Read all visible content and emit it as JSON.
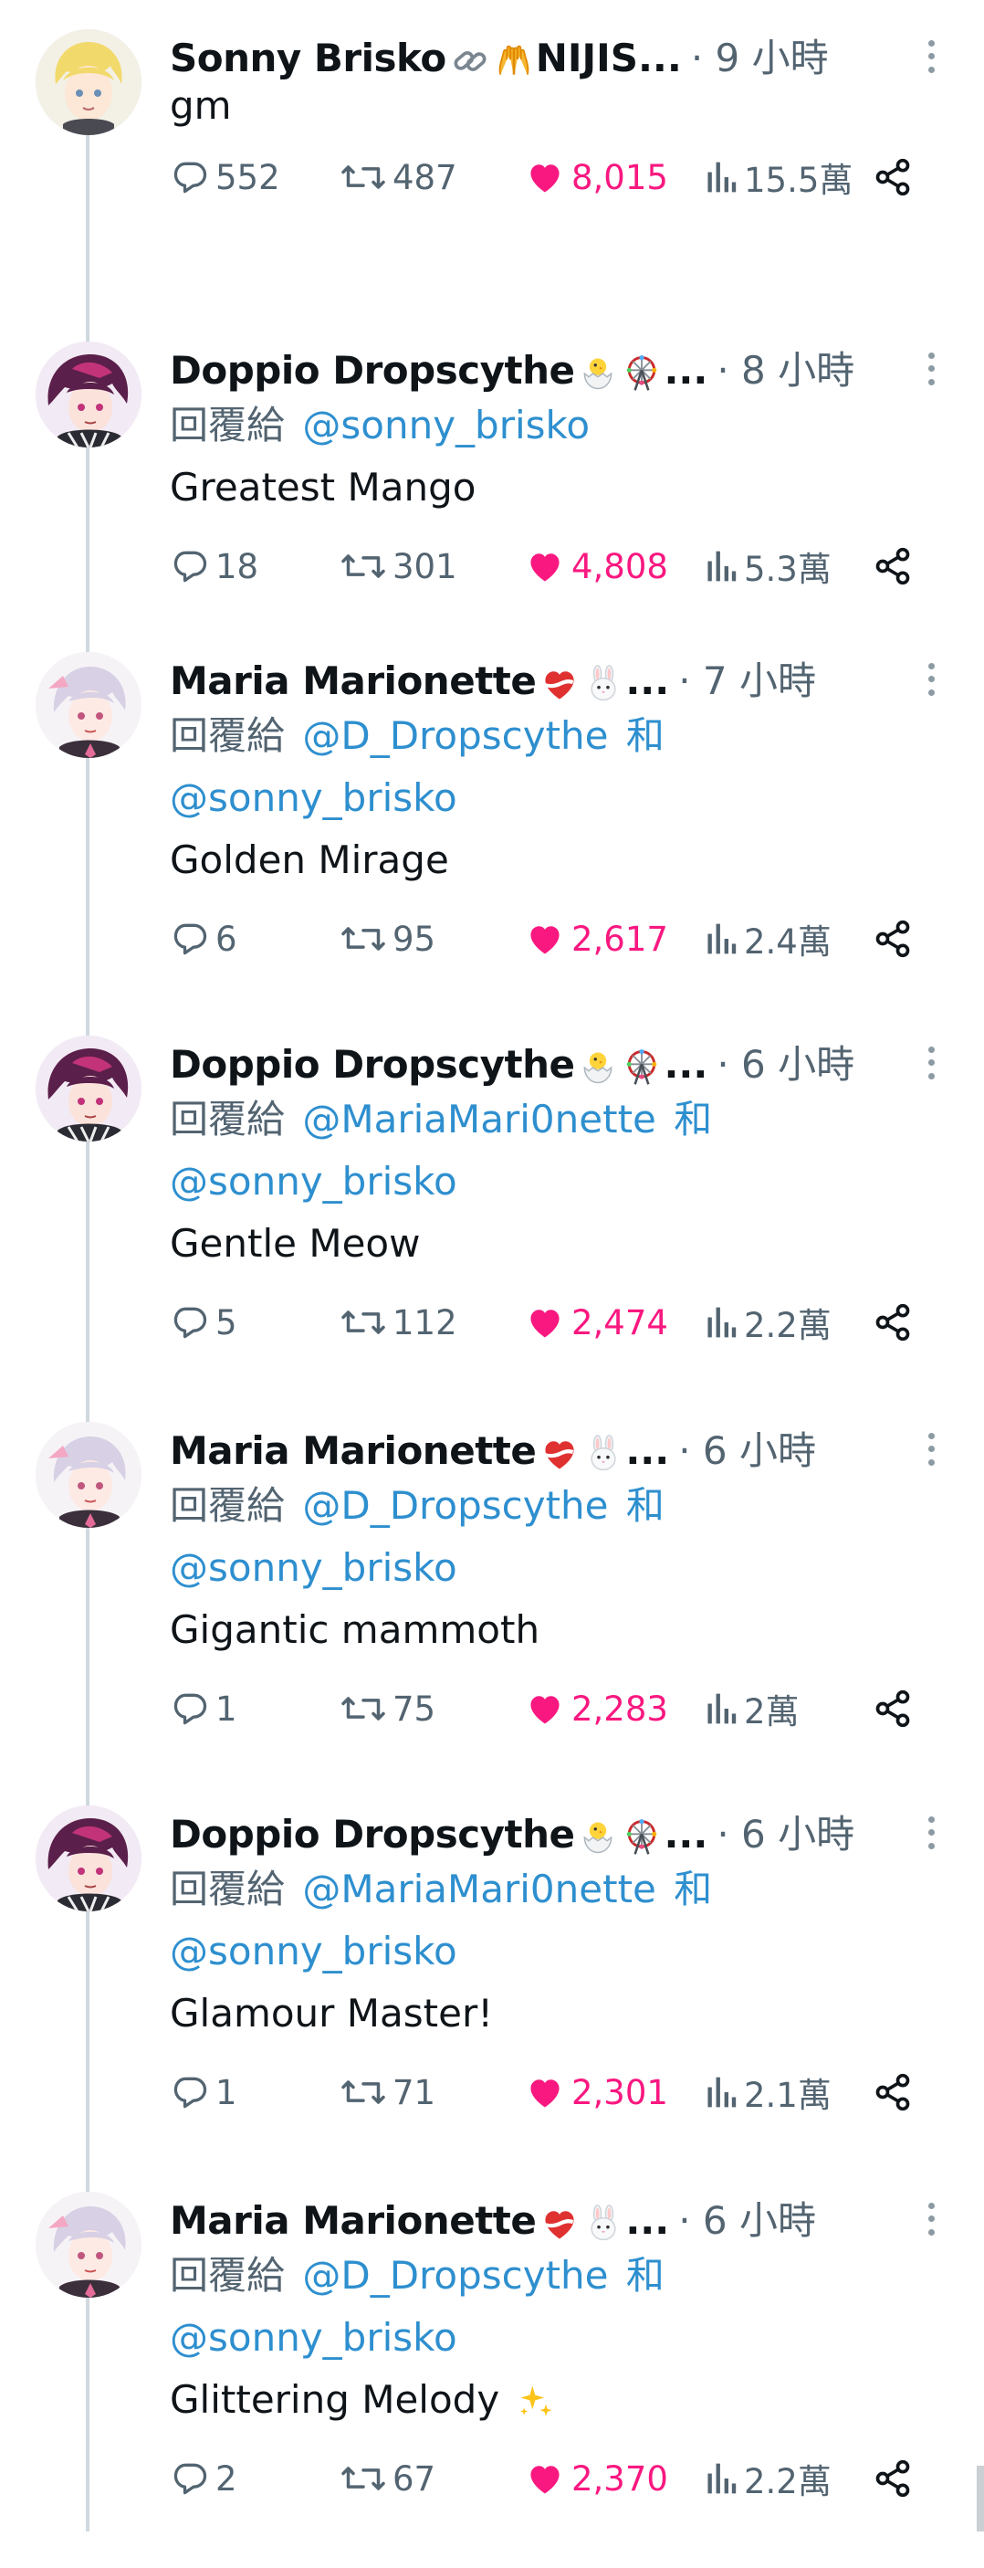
{
  "tweets": [
    {
      "name": "Sonny Brisko",
      "name_suffix": "NIJIS...",
      "emojis": [
        "link-icon",
        "hands-icon"
      ],
      "time": "9 小時",
      "reply_prefix": "",
      "mention_line1": "",
      "mention_and": "",
      "mention_line2": "",
      "text": "gm",
      "replies": "552",
      "retweets": "487",
      "likes": "8,015",
      "views": "15.5萬",
      "avatar": "sonny"
    },
    {
      "name": "Doppio Dropscythe",
      "name_suffix": "...",
      "emojis": [
        "hatching-chick-icon",
        "ferris-wheel-icon"
      ],
      "time": "8 小時",
      "reply_prefix": "回覆給",
      "mention_line1": "@sonny_brisko",
      "mention_and": "",
      "mention_line2": "",
      "text": "Greatest Mango",
      "replies": "18",
      "retweets": "301",
      "likes": "4,808",
      "views": "5.3萬",
      "avatar": "doppio"
    },
    {
      "name": "Maria Marionette",
      "name_suffix": "...",
      "emojis": [
        "heart-ribbon-icon",
        "rabbit-face-icon"
      ],
      "time": "7 小時",
      "reply_prefix": "回覆給",
      "mention_line1": "@D_Dropscythe",
      "mention_and": "和",
      "mention_line2": "@sonny_brisko",
      "text": "Golden Mirage",
      "replies": "6",
      "retweets": "95",
      "likes": "2,617",
      "views": "2.4萬",
      "avatar": "maria"
    },
    {
      "name": "Doppio Dropscythe",
      "name_suffix": "...",
      "emojis": [
        "hatching-chick-icon",
        "ferris-wheel-icon"
      ],
      "time": "6 小時",
      "reply_prefix": "回覆給",
      "mention_line1": "@MariaMari0nette",
      "mention_and": "和",
      "mention_line2": "@sonny_brisko",
      "text": "Gentle Meow",
      "replies": "5",
      "retweets": "112",
      "likes": "2,474",
      "views": "2.2萬",
      "avatar": "doppio"
    },
    {
      "name": "Maria Marionette",
      "name_suffix": "...",
      "emojis": [
        "heart-ribbon-icon",
        "rabbit-face-icon"
      ],
      "time": "6 小時",
      "reply_prefix": "回覆給",
      "mention_line1": "@D_Dropscythe",
      "mention_and": "和",
      "mention_line2": "@sonny_brisko",
      "text": "Gigantic mammoth",
      "replies": "1",
      "retweets": "75",
      "likes": "2,283",
      "views": "2萬",
      "avatar": "maria"
    },
    {
      "name": "Doppio Dropscythe",
      "name_suffix": "...",
      "emojis": [
        "hatching-chick-icon",
        "ferris-wheel-icon"
      ],
      "time": "6 小時",
      "reply_prefix": "回覆給",
      "mention_line1": "@MariaMari0nette",
      "mention_and": "和",
      "mention_line2": "@sonny_brisko",
      "text": "Glamour Master!",
      "replies": "1",
      "retweets": "71",
      "likes": "2,301",
      "views": "2.1萬",
      "avatar": "doppio"
    },
    {
      "name": "Maria Marionette",
      "name_suffix": "...",
      "emojis": [
        "heart-ribbon-icon",
        "rabbit-face-icon"
      ],
      "time": "6 小時",
      "reply_prefix": "回覆給",
      "mention_line1": "@D_Dropscythe",
      "mention_and": "和",
      "mention_line2": "@sonny_brisko",
      "text": "Glittering Melody",
      "text_emoji": "sparkles-icon",
      "replies": "2",
      "retweets": "67",
      "likes": "2,370",
      "views": "2.2萬",
      "avatar": "maria"
    }
  ],
  "colors": {
    "like": "#f91880",
    "mention": "#2e8fcf",
    "secondary": "#536471",
    "thread_line": "#cfd9de"
  }
}
